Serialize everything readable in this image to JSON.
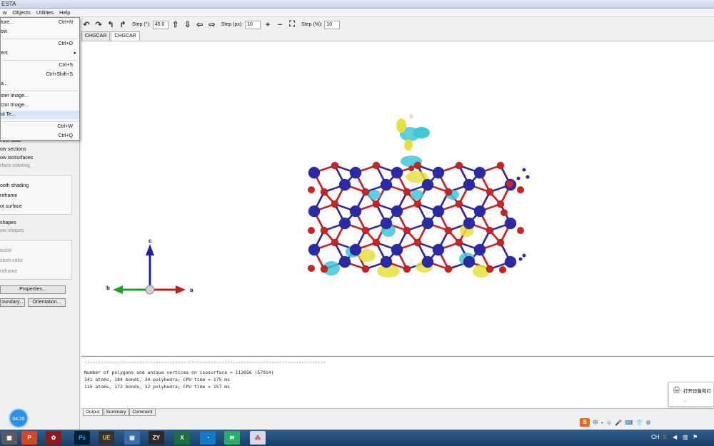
{
  "window": {
    "title": "ESTA"
  },
  "menu": {
    "items": [
      "w",
      "Objects",
      "Utilities",
      "Help"
    ]
  },
  "file_menu": {
    "items": [
      {
        "label": "ture...",
        "shortcut": "Ctrl+N"
      },
      {
        "label": "ow",
        "shortcut": ""
      },
      {
        "label": "",
        "shortcut": "Ctrl+O"
      },
      {
        "label": "ent",
        "shortcut": ""
      },
      {
        "label": "",
        "shortcut": "Ctrl+S"
      },
      {
        "label": "",
        "shortcut": "Ctrl+Shift+S"
      },
      {
        "label": "a...",
        "shortcut": ""
      },
      {
        "label": "ster Image...",
        "shortcut": ""
      },
      {
        "label": "ctor Image...",
        "shortcut": ""
      },
      {
        "label": "ut Te...",
        "shortcut": ""
      },
      {
        "label": "",
        "shortcut": "Ctrl+W"
      },
      {
        "label": "",
        "shortcut": "Ctrl+Q"
      }
    ]
  },
  "toolbar": {
    "step_deg_label": "Step (°):",
    "step_deg_value": "45.0",
    "step_px_label": "Step (px):",
    "step_px_value": "10",
    "step_pct_label": "Step (%):",
    "step_pct_value": "10"
  },
  "tabs": [
    "CHGCAR",
    "CHGCAR"
  ],
  "left_panel": {
    "volumetric_data": "etric data",
    "show_sections": "ow sections",
    "show_isosurfaces": "ow isosurfaces",
    "surface_coloring": "rface coloring",
    "smooth_shading": "ooth shading",
    "wireframe1": "reframe",
    "dot_surface": "ot surface",
    "shapes": "shapes",
    "show_shapes": "ow shapes",
    "color1": "icolor",
    "custom_color": "stom color",
    "wireframe2": "reframe",
    "properties_btn": "Properties...",
    "boundary_btn": "oundary...",
    "orientation_btn": "Orientation..."
  },
  "axes": {
    "c": "c",
    "b": "b",
    "a": "a"
  },
  "output": {
    "separator": "------------------------------------------------------------------------------------------------------------------------",
    "lines": [
      "Number of polygons and unique vertices on isosurface = 113056 (57914)",
      "141 atoms, 184 bonds, 34 polyhedra; CPU time = 175 ms",
      "",
      "115 atoms, 172 bonds, 32 polyhedra; CPU time = 157 ms"
    ]
  },
  "output_tabs": [
    "Output",
    "Summary",
    "Comment"
  ],
  "notification": {
    "title": "打开设备和打",
    "sub": "..."
  },
  "timestamp": "04:26",
  "taskbar": {
    "apps": [
      "PowerPoint",
      "App",
      "Ps",
      "UE",
      "Calc",
      "ZY",
      "Excel",
      "Edge",
      "WeChat",
      "VESTA"
    ]
  },
  "ime": {
    "logo": "S",
    "items": [
      "中",
      "•",
      "☺",
      "🎤",
      "⌨",
      "👕",
      "⚙"
    ]
  },
  "colors": {
    "oxygen": "#cc2222",
    "metal": "#2a2aa8",
    "iso_pos": "#e8e040",
    "iso_neg": "#40c8d8"
  }
}
